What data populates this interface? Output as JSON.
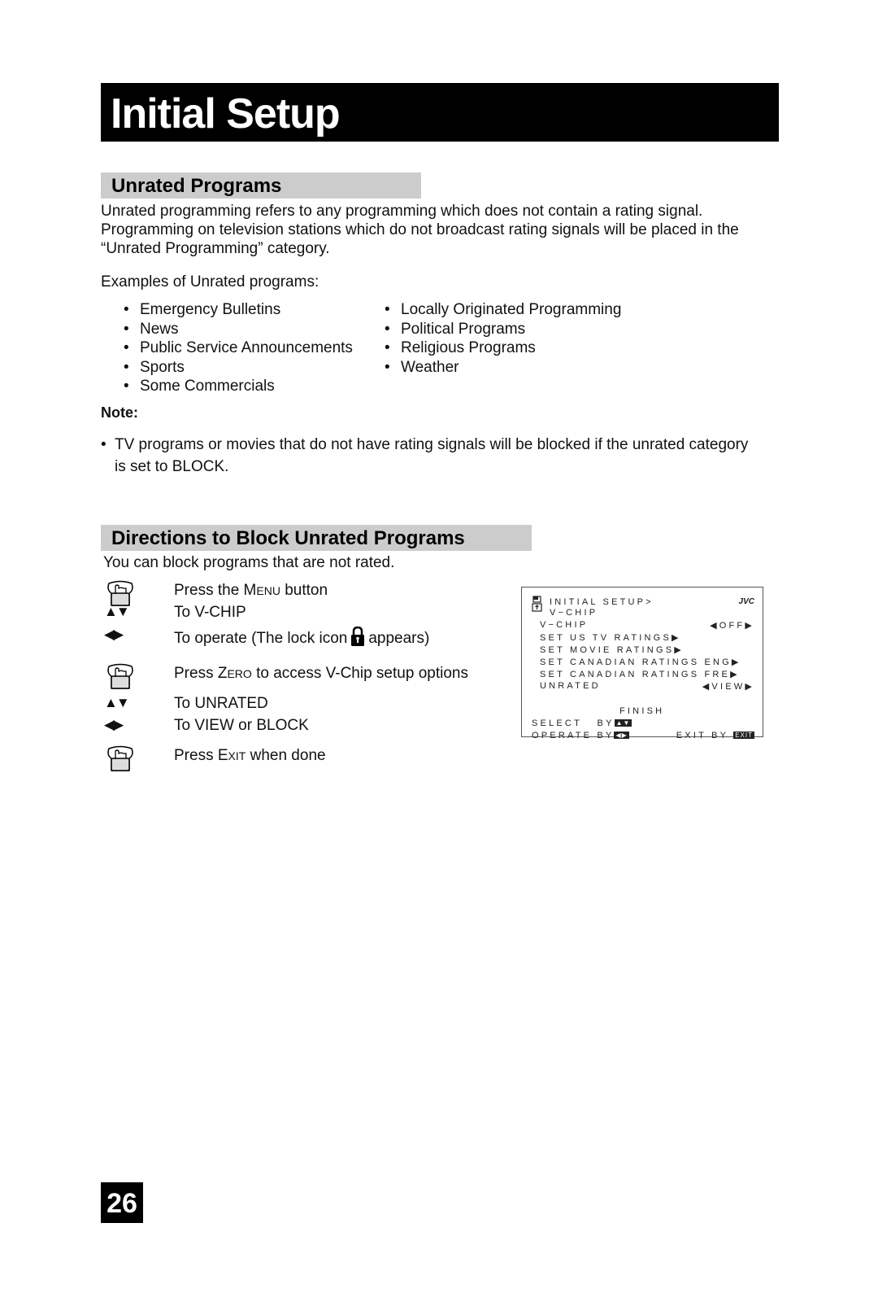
{
  "page": {
    "title": "Initial Setup",
    "page_number": "26"
  },
  "unrated": {
    "heading": "Unrated Programs",
    "intro_lines": [
      "Unrated programming refers to any programming which does not contain a rating signal.",
      "Programming on television stations which do not broadcast rating signals will be placed in the",
      "“Unrated Programming” category."
    ],
    "examples_label": "Examples of Unrated programs:",
    "examples_left": [
      "Emergency Bulletins",
      "News",
      "Public Service Announcements",
      "Sports",
      "Some Commercials"
    ],
    "examples_right": [
      "Locally Originated Programming",
      "Political Programs",
      "Religious Programs",
      "Weather"
    ],
    "note_label": "Note:",
    "note_lines": [
      "TV programs or movies that do not have rating signals will be blocked if the unrated category",
      "is set to BLOCK."
    ]
  },
  "directions": {
    "heading": "Directions to Block Unrated Programs",
    "intro": "You can block programs that are not rated.",
    "steps": [
      {
        "icon": "hand-press-icon",
        "pre": "Press the ",
        "key_first": "M",
        "key_rest": "enu",
        "post": " button"
      },
      {
        "icon": "up-down-arrows-icon",
        "arrows": "▲▼",
        "text": "To V-CHIP"
      },
      {
        "icon": "left-right-arrows-icon",
        "arrows": "◀▶",
        "text_pre": "To operate (The lock icon",
        "text_post": "appears)"
      },
      {
        "icon": "hand-press-icon",
        "pre": "Press ",
        "key_first": "Z",
        "key_rest": "ero",
        "post": " to access V-Chip setup options"
      },
      {
        "icon": "up-down-arrows-icon",
        "arrows": "▲▼",
        "text": "To UNRATED"
      },
      {
        "icon": "left-right-arrows-icon",
        "arrows": "◀▶",
        "text": "To VIEW or BLOCK"
      },
      {
        "icon": "hand-press-icon",
        "pre": "Press ",
        "key_first": "E",
        "key_rest": "xit",
        "post": " when done"
      }
    ]
  },
  "osd": {
    "breadcrumb": "INITIAL SETUP>",
    "submenu": "V−CHIP",
    "brand": "JVC",
    "items": [
      {
        "label": "V−CHIP",
        "value": "◀OFF▶"
      },
      {
        "label": "SET US TV RATINGS▶",
        "value": ""
      },
      {
        "label": "SET MOVIE RATINGS▶",
        "value": ""
      },
      {
        "label": "SET CANADIAN RATINGS ENG▶",
        "value": ""
      },
      {
        "label": "SET CANADIAN RATINGS FRE▶",
        "value": ""
      },
      {
        "label": "UNRATED",
        "value": "◀VIEW▶"
      }
    ],
    "finish": "FINISH",
    "select_label": "SELECT   BY",
    "operate_label": "OPERATE BY",
    "exit_label": "EXIT BY",
    "exit_key": "EXIT"
  }
}
